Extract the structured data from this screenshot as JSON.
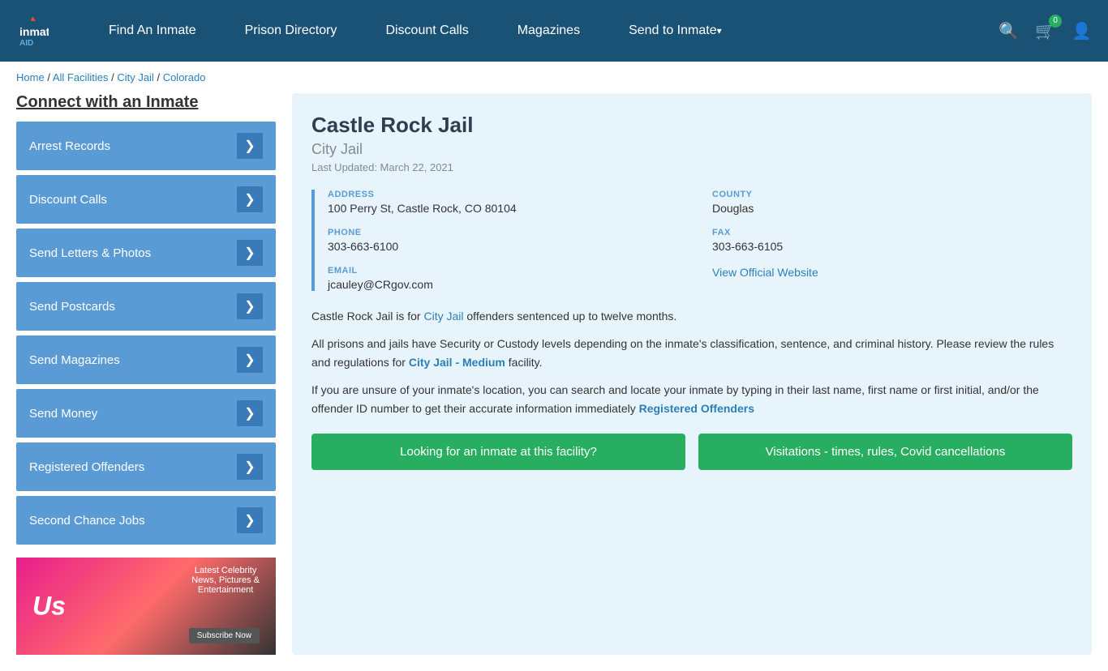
{
  "header": {
    "logo": "inmateAID",
    "nav": [
      {
        "label": "Find An Inmate",
        "url": "#",
        "hasArrow": false
      },
      {
        "label": "Prison Directory",
        "url": "#",
        "hasArrow": false
      },
      {
        "label": "Discount Calls",
        "url": "#",
        "hasArrow": false
      },
      {
        "label": "Magazines",
        "url": "#",
        "hasArrow": false
      },
      {
        "label": "Send to Inmate",
        "url": "#",
        "hasArrow": true
      }
    ],
    "cart_count": "0"
  },
  "breadcrumb": {
    "items": [
      "Home",
      "All Facilities",
      "City Jail",
      "Colorado"
    ]
  },
  "sidebar": {
    "title": "Connect with an Inmate",
    "menu": [
      {
        "label": "Arrest Records"
      },
      {
        "label": "Discount Calls"
      },
      {
        "label": "Send Letters & Photos"
      },
      {
        "label": "Send Postcards"
      },
      {
        "label": "Send Magazines"
      },
      {
        "label": "Send Money"
      },
      {
        "label": "Registered Offenders"
      },
      {
        "label": "Second Chance Jobs"
      }
    ],
    "ad": {
      "logo": "Us",
      "line1": "Latest Celebrity",
      "line2": "News, Pictures &",
      "line3": "Entertainment",
      "button": "Subscribe Now"
    }
  },
  "facility": {
    "title": "Castle Rock Jail",
    "type": "City Jail",
    "last_updated": "Last Updated: March 22, 2021",
    "address_label": "ADDRESS",
    "address_value": "100 Perry St, Castle Rock, CO 80104",
    "county_label": "COUNTY",
    "county_value": "Douglas",
    "phone_label": "PHONE",
    "phone_value": "303-663-6100",
    "fax_label": "FAX",
    "fax_value": "303-663-6105",
    "email_label": "EMAIL",
    "email_value": "jcauley@CRgov.com",
    "website_label": "View Official Website",
    "website_url": "#",
    "desc1": "Castle Rock Jail is for City Jail offenders sentenced up to twelve months.",
    "desc2": "All prisons and jails have Security or Custody levels depending on the inmate's classification, sentence, and criminal history. Please review the rules and regulations for City Jail - Medium facility.",
    "desc3": "If you are unsure of your inmate's location, you can search and locate your inmate by typing in their last name, first name or first initial, and/or the offender ID number to get their accurate information immediately Registered Offenders",
    "btn1": "Looking for an inmate at this facility?",
    "btn2": "Visitations - times, rules, Covid cancellations"
  }
}
